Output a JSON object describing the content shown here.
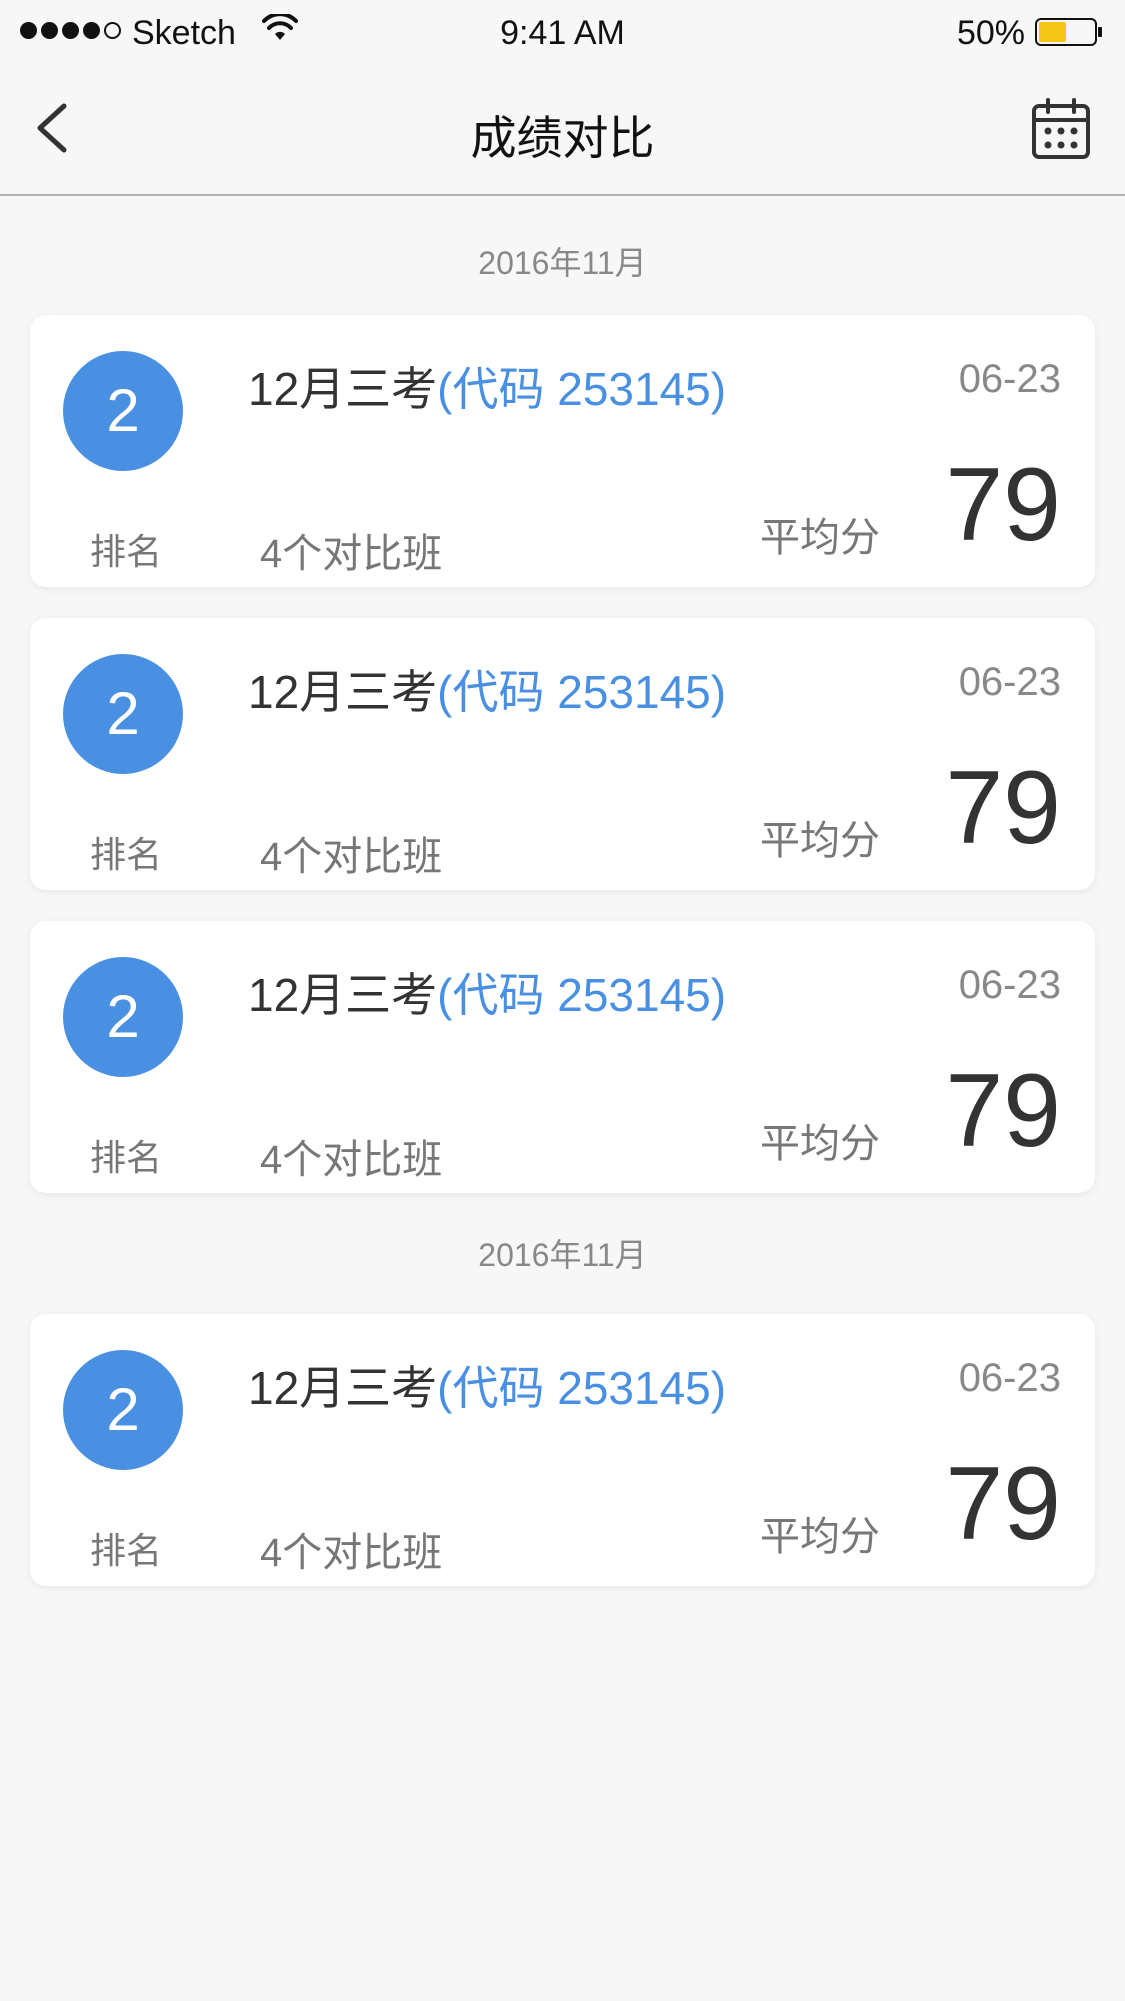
{
  "status_bar": {
    "carrier": "Sketch",
    "time": "9:41 AM",
    "battery_percent": "50%",
    "battery_level": 0.5,
    "battery_color": "#f5c518"
  },
  "nav": {
    "title": "成绩对比",
    "back_icon": "chevron-left-icon",
    "calendar_icon": "calendar-icon"
  },
  "colors": {
    "accent": "#4a90e2"
  },
  "sections": [
    {
      "month": "2016年11月",
      "cards": [
        {
          "rank": "2",
          "rank_label": "排名",
          "title": "12月三考",
          "code": "(代码 253145)",
          "date": "06-23",
          "classes": "4个对比班",
          "avg_label": "平均分",
          "score": "79"
        },
        {
          "rank": "2",
          "rank_label": "排名",
          "title": "12月三考",
          "code": "(代码 253145)",
          "date": "06-23",
          "classes": "4个对比班",
          "avg_label": "平均分",
          "score": "79"
        },
        {
          "rank": "2",
          "rank_label": "排名",
          "title": "12月三考",
          "code": "(代码 253145)",
          "date": "06-23",
          "classes": "4个对比班",
          "avg_label": "平均分",
          "score": "79"
        }
      ]
    },
    {
      "month": "2016年11月",
      "cards": [
        {
          "rank": "2",
          "rank_label": "排名",
          "title": "12月三考",
          "code": "(代码 253145)",
          "date": "06-23",
          "classes": "4个对比班",
          "avg_label": "平均分",
          "score": "79"
        }
      ]
    }
  ]
}
